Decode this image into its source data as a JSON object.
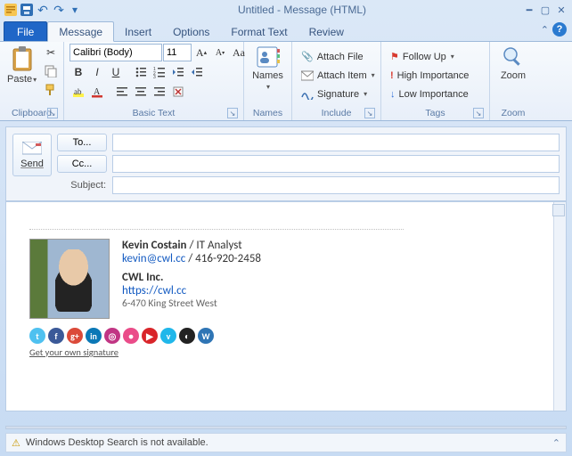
{
  "window": {
    "title": "Untitled - Message (HTML)"
  },
  "tabs": {
    "file": "File",
    "items": [
      "Message",
      "Insert",
      "Options",
      "Format Text",
      "Review"
    ],
    "active": 0
  },
  "ribbon": {
    "clipboard": {
      "paste": "Paste",
      "label": "Clipboard"
    },
    "basicText": {
      "font": "Calibri (Body)",
      "size": "11",
      "label": "Basic Text"
    },
    "names": {
      "names": "Names",
      "label": "Names"
    },
    "include": {
      "attachFile": "Attach File",
      "attachItem": "Attach Item",
      "signature": "Signature",
      "label": "Include"
    },
    "tags": {
      "followUp": "Follow Up",
      "high": "High Importance",
      "low": "Low Importance",
      "label": "Tags"
    },
    "zoom": {
      "zoom": "Zoom",
      "label": "Zoom"
    }
  },
  "compose": {
    "send": "Send",
    "to": "To...",
    "cc": "Cc...",
    "subjectLabel": "Subject:",
    "toValue": "",
    "ccValue": "",
    "subjectValue": ""
  },
  "signature": {
    "name": "Kevin Costain",
    "title": "IT Analyst",
    "email": "kevin@cwl.cc",
    "phone": "416-920-2458",
    "company": "CWL Inc.",
    "url": "https://cwl.cc",
    "address": "6-470 King Street West",
    "getYourOwn": "Get your own signature",
    "social": [
      {
        "name": "twitter",
        "bg": "#4fc1f0",
        "glyph": "t"
      },
      {
        "name": "facebook",
        "bg": "#3b5998",
        "glyph": "f"
      },
      {
        "name": "google-plus",
        "bg": "#db4a39",
        "glyph": "g+"
      },
      {
        "name": "linkedin",
        "bg": "#0b78b6",
        "glyph": "in"
      },
      {
        "name": "instagram",
        "bg": "#c13584",
        "glyph": "◎"
      },
      {
        "name": "dribbble",
        "bg": "#ea4c89",
        "glyph": "●"
      },
      {
        "name": "youtube",
        "bg": "#d9252a",
        "glyph": "▶"
      },
      {
        "name": "vimeo",
        "bg": "#20b7ea",
        "glyph": "v"
      },
      {
        "name": "github",
        "bg": "#222",
        "glyph": "◐"
      },
      {
        "name": "wordpress",
        "bg": "#2f75b5",
        "glyph": "W"
      }
    ]
  },
  "status": {
    "message": "Windows Desktop Search is not available."
  }
}
